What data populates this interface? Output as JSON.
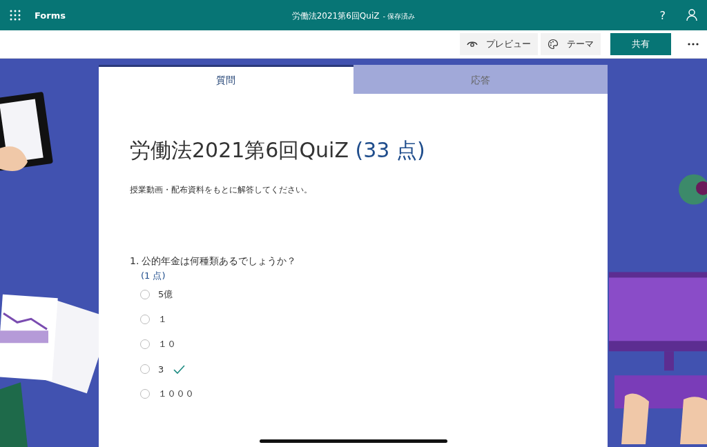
{
  "app_bar": {
    "app_name": "Forms",
    "title": "労働法2021第6回QuiZ",
    "status": "- 保存済み",
    "help": "?"
  },
  "toolbar": {
    "preview": "プレビュー",
    "theme": "テーマ",
    "share": "共有"
  },
  "tabs": [
    {
      "label": "質問",
      "selected": true
    },
    {
      "label": "応答",
      "selected": false
    }
  ],
  "form": {
    "title": "労働法2021第6回QuiZ",
    "points": "(33 点)",
    "description": "授業動画・配布資料をもとに解答してください。",
    "questions": [
      {
        "number": "1.",
        "text": "公的年金は何種類あるでしょうか？",
        "points": "(1 点)",
        "options": [
          {
            "label": "5億",
            "selected": false,
            "correct": false
          },
          {
            "label": "１",
            "selected": false,
            "correct": false
          },
          {
            "label": "１０",
            "selected": false,
            "correct": false
          },
          {
            "label": "3",
            "selected": false,
            "correct": true
          },
          {
            "label": "１０００",
            "selected": false,
            "correct": false
          }
        ]
      }
    ]
  }
}
